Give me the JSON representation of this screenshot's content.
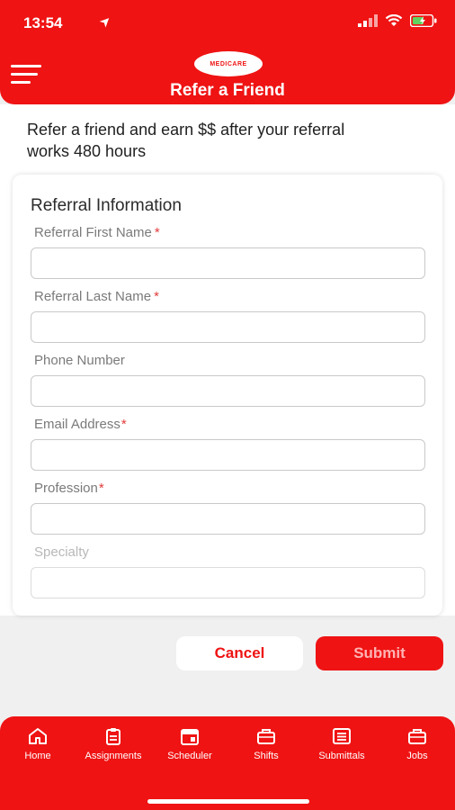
{
  "status_bar": {
    "time": "13:54",
    "location_glyph": "➤"
  },
  "header": {
    "logo_text": "MEDICARE",
    "title": "Refer a Friend"
  },
  "intro_text": "Refer a friend and earn $$ after your referral works 480 hours",
  "form": {
    "section_title": "Referral Information",
    "required_mark": "*",
    "fields": [
      {
        "label": "Referral First Name",
        "required": true,
        "value": "",
        "placeholder": ""
      },
      {
        "label": "Referral Last Name",
        "required": true,
        "value": "",
        "placeholder": ""
      },
      {
        "label": "Phone Number",
        "required": false,
        "value": "",
        "placeholder": ""
      },
      {
        "label": "Email Address",
        "required": true,
        "value": "",
        "placeholder": ""
      },
      {
        "label": "Profession",
        "required": true,
        "value": "",
        "placeholder": ""
      },
      {
        "label": "Specialty",
        "required": false,
        "value": "",
        "placeholder": ""
      }
    ]
  },
  "actions": {
    "cancel_label": "Cancel",
    "submit_label": "Submit"
  },
  "bottom_nav": {
    "items": [
      {
        "label": "Home",
        "icon": "home-icon"
      },
      {
        "label": "Assignments",
        "icon": "clipboard-icon"
      },
      {
        "label": "Scheduler",
        "icon": "calendar-icon"
      },
      {
        "label": "Shifts",
        "icon": "briefcase-icon"
      },
      {
        "label": "Submittals",
        "icon": "document-list-icon"
      },
      {
        "label": "Jobs",
        "icon": "briefcase-icon"
      }
    ]
  },
  "colors": {
    "brand": "#ef1313",
    "background": "#f0f0f0",
    "required": "#e23b3b"
  }
}
